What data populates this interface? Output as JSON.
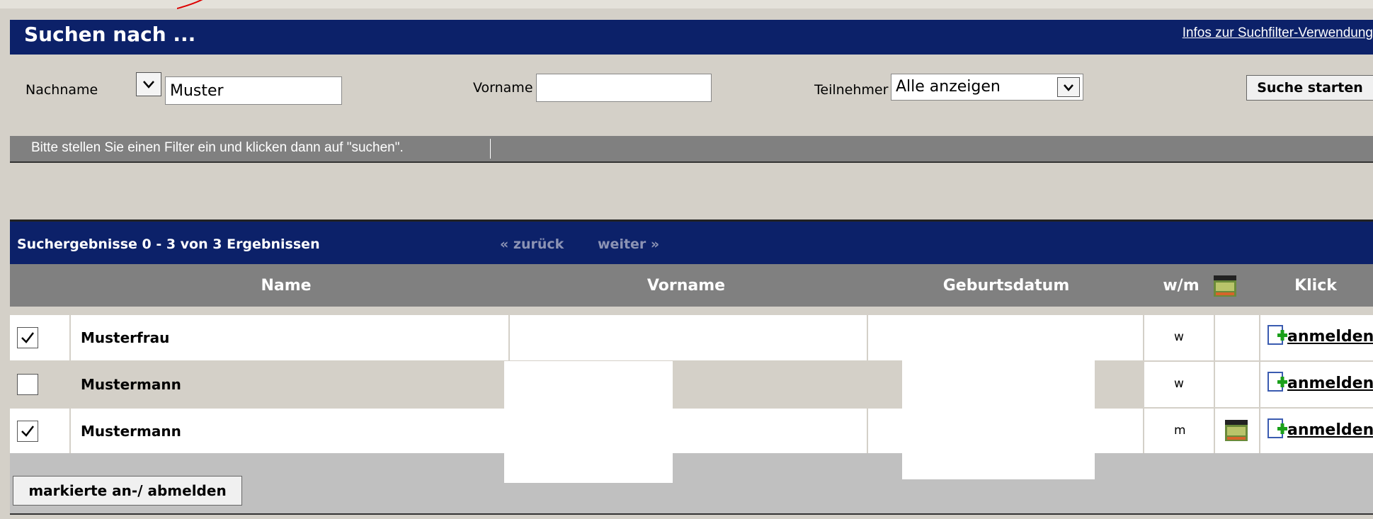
{
  "search": {
    "title": "Suchen nach ...",
    "info_link": "Infos zur Suchfilter-Verwendung",
    "nachname_label": "Nachname",
    "nachname_value": "Muster",
    "vorname_label": "Vorname",
    "vorname_value": "",
    "teilnehmer_label": "Teilnehmer",
    "teilnehmer_selected": "Alle anzeigen",
    "start_button": "Suche starten",
    "hint": "Bitte stellen Sie einen Filter ein und klicken dann auf \"suchen\"."
  },
  "results": {
    "summary": "Suchergebnisse 0 - 3 von 3 Ergebnissen",
    "prev": "« zurück",
    "next": "weiter »",
    "columns": {
      "name": "Name",
      "vorname": "Vorname",
      "geburtsdatum": "Geburtsdatum",
      "wm": "w/m",
      "klick": "Klick"
    },
    "rows": [
      {
        "checked": true,
        "name": "Musterfrau",
        "vorname": "",
        "geburtsdatum": "",
        "wm": "w",
        "has_icon": false,
        "action": "anmelden"
      },
      {
        "checked": false,
        "name": "Mustermann",
        "vorname": "",
        "geburtsdatum": "",
        "wm": "w",
        "has_icon": false,
        "action": "anmelden"
      },
      {
        "checked": true,
        "name": "Mustermann",
        "vorname": "",
        "geburtsdatum": "",
        "wm": "m",
        "has_icon": true,
        "action": "anmelden"
      }
    ],
    "bulk_button": "markierte an-/ abmelden"
  },
  "colors": {
    "header_blue": "#0c2169",
    "panel_gray": "#d4d0c8",
    "bar_gray": "#808080"
  },
  "icons": [
    "chevron-down-icon",
    "checkbox-check-icon",
    "calendar-icon",
    "add-document-icon"
  ]
}
